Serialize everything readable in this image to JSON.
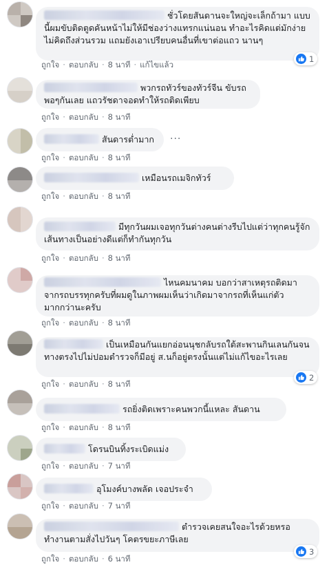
{
  "actions": {
    "like": "ถูกใจ",
    "reply": "ตอบกลับ",
    "edited": "แก้ไขแล้ว",
    "separator": "·"
  },
  "colors": {
    "bubble": "#f2f3f5",
    "like_badge": "#1877f2",
    "meta": "#606770"
  },
  "comments": [
    {
      "text": "ชั่วโดยสันดานจะใหญ่จะเล็กถ้ามา แบบนี้ผมขับติดตูดคันหน้าไม่ให้มีช่องว่างแทรกแน่นอน ทำอะไรคิดแต่มักง่ายไม่คิดถึงส่วนรวม แถมยังเอาเปรียบคนอื่นที่เขาต่อแถว นานๆ",
      "time": "8 นาที",
      "reactions": "1",
      "reaction_icon": "like-icon"
    },
    {
      "text": "พวกรถทัวร์ของทัวร์จีน ขับรถพอๆกันเลย แถวรัชดาจอดทำให้รถติดเพียบ",
      "time": "8 นาที"
    },
    {
      "text": "สันดารต่ำมาก",
      "time": "8 นาที",
      "more_icon": "more-options-icon"
    },
    {
      "text": "เหมือนรถเมจิกทัวร์",
      "time": "8 นาที"
    },
    {
      "text": "มีทุกวันผมเจอทุกวันต่างคนต่างรีบไปแต่ว่าทุกคนรู้จักเส้นทางเป็นอย่างดีแต่ก็ทำกันทุกวัน",
      "time": "8 นาที"
    },
    {
      "text": "ไหนคมนาคม บอกว่าสาเหตุรถติดมาจากรถบรรทุกครับที่ผมดูในภาพผมเห็นว่าเกิดมาจากรถที่เห็นแก่ตัวมากกว่านะครับ",
      "time": "8 นาที"
    },
    {
      "text": "เป็นเหมือนกันแยกอ่อนนุชกลับรถใต้สะพานกินเลนกันจนทางตรงไปไม่ปอมตำรวจก็มีอยู่ ส.นก็อยู่ตรงนั้นแต่ไม่แก้ไขอะไรเลย",
      "time": "8 นาที",
      "reactions": "2",
      "reaction_icon": "like-icon"
    },
    {
      "text": "รถยิ่งติดเพราะคนพวกนี้แหละ สันดาน",
      "time": "8 นาที"
    },
    {
      "text": "โดรนบินทิ้งระเบิดแม่ง",
      "time": "7 นาที"
    },
    {
      "text": "อุโมงค์บางพลัด เจอประจำ",
      "time": "7 นาที"
    },
    {
      "text": "ตำรวจเคยสนใจอะไรด้วยหรอ ทำงานตามสั่งไปวันๆ โคตรขยะภาษีเลย",
      "time": "6 นาที",
      "reactions": "3",
      "reaction_icon": "like-icon"
    }
  ]
}
